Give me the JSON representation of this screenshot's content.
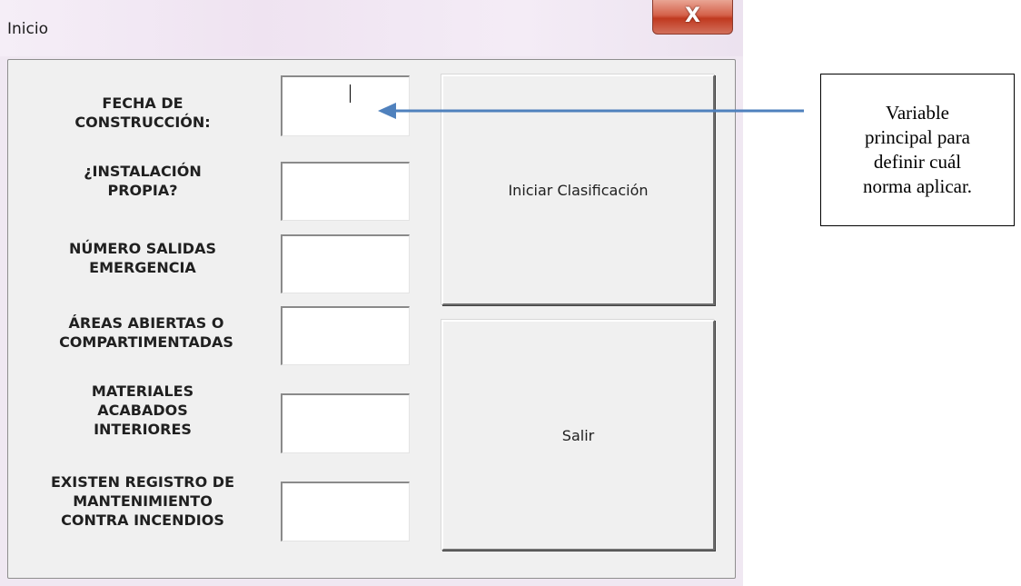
{
  "window": {
    "title": "Inicio",
    "close_glyph": "X"
  },
  "form": {
    "fields": [
      {
        "id": "fecha",
        "label": "FECHA DE\nCONSTRUCCIÓN:",
        "value": ""
      },
      {
        "id": "instalacion",
        "label": "¿INSTALACIÓN\nPROPIA?",
        "value": ""
      },
      {
        "id": "salidas",
        "label": "NÚMERO SALIDAS\nEMERGENCIA",
        "value": ""
      },
      {
        "id": "areas",
        "label": "ÁREAS ABIERTAS O\nCOMPARTIMENTADAS",
        "value": ""
      },
      {
        "id": "materiales",
        "label": "MATERIALES\nACABADOS\nINTERIORES",
        "value": ""
      },
      {
        "id": "registro",
        "label": "EXISTEN REGISTRO DE\nMANTENIMIENTO\nCONTRA INCENDIOS",
        "value": ""
      }
    ],
    "buttons": {
      "iniciar_label": "Iniciar Clasificación",
      "salir_label": "Salir"
    }
  },
  "annotation": {
    "callout_text": "Variable\nprincipal para\ndefinir cuál\nnorma aplicar.",
    "arrow_color": "#4f81bd"
  },
  "colors": {
    "close_button": "#c0391f",
    "client_background": "#f0f0f0"
  }
}
